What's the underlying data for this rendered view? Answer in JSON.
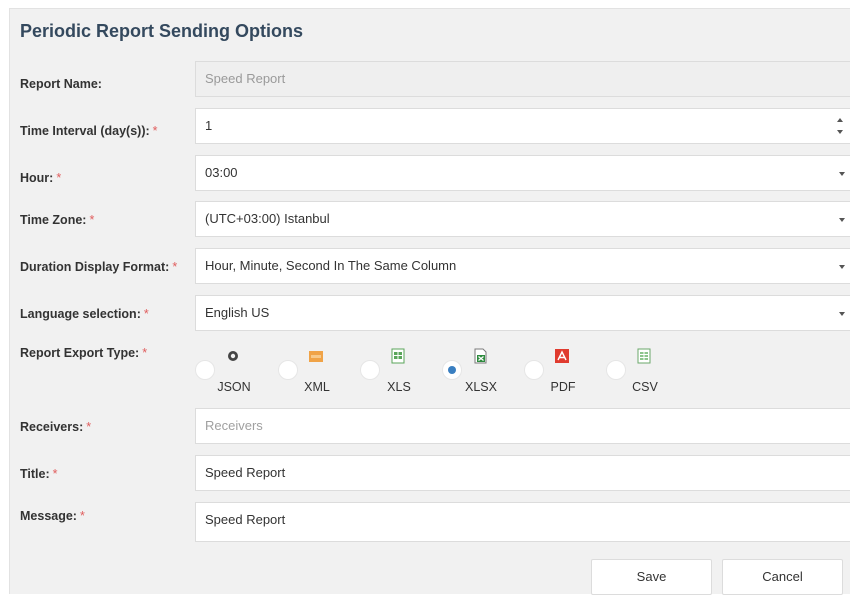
{
  "form": {
    "title": "Periodic Report Sending Options",
    "required_mark": "*",
    "report_name": {
      "label": "Report Name:",
      "placeholder": "Speed Report"
    },
    "time_interval": {
      "label": "Time Interval (day(s)):",
      "value": "1"
    },
    "hour": {
      "label": "Hour:",
      "value": "03:00"
    },
    "time_zone": {
      "label": "Time Zone:",
      "value": "(UTC+03:00) Istanbul"
    },
    "duration_format": {
      "label": "Duration Display Format:",
      "value": "Hour, Minute, Second In The Same Column"
    },
    "language": {
      "label": "Language selection:",
      "value": "English US"
    },
    "export_type": {
      "label": "Report Export Type:",
      "selected": "XLSX",
      "options": [
        {
          "label": "JSON",
          "icon": "json-file-icon"
        },
        {
          "label": "XML",
          "icon": "xml-file-icon"
        },
        {
          "label": "XLS",
          "icon": "xls-file-icon"
        },
        {
          "label": "XLSX",
          "icon": "xlsx-file-icon"
        },
        {
          "label": "PDF",
          "icon": "pdf-file-icon"
        },
        {
          "label": "CSV",
          "icon": "csv-file-icon"
        }
      ]
    },
    "receivers": {
      "label": "Receivers:",
      "placeholder": "Receivers"
    },
    "title_field": {
      "label": "Title:",
      "value": "Speed Report"
    },
    "message": {
      "label": "Message:",
      "value": "Speed Report"
    },
    "buttons": {
      "save": "Save",
      "cancel": "Cancel"
    }
  },
  "colors": {
    "title": "#34495e",
    "required": "#e05c5c",
    "radio_checked": "#3a7fc1",
    "panel_bg": "#f1f1f1"
  }
}
